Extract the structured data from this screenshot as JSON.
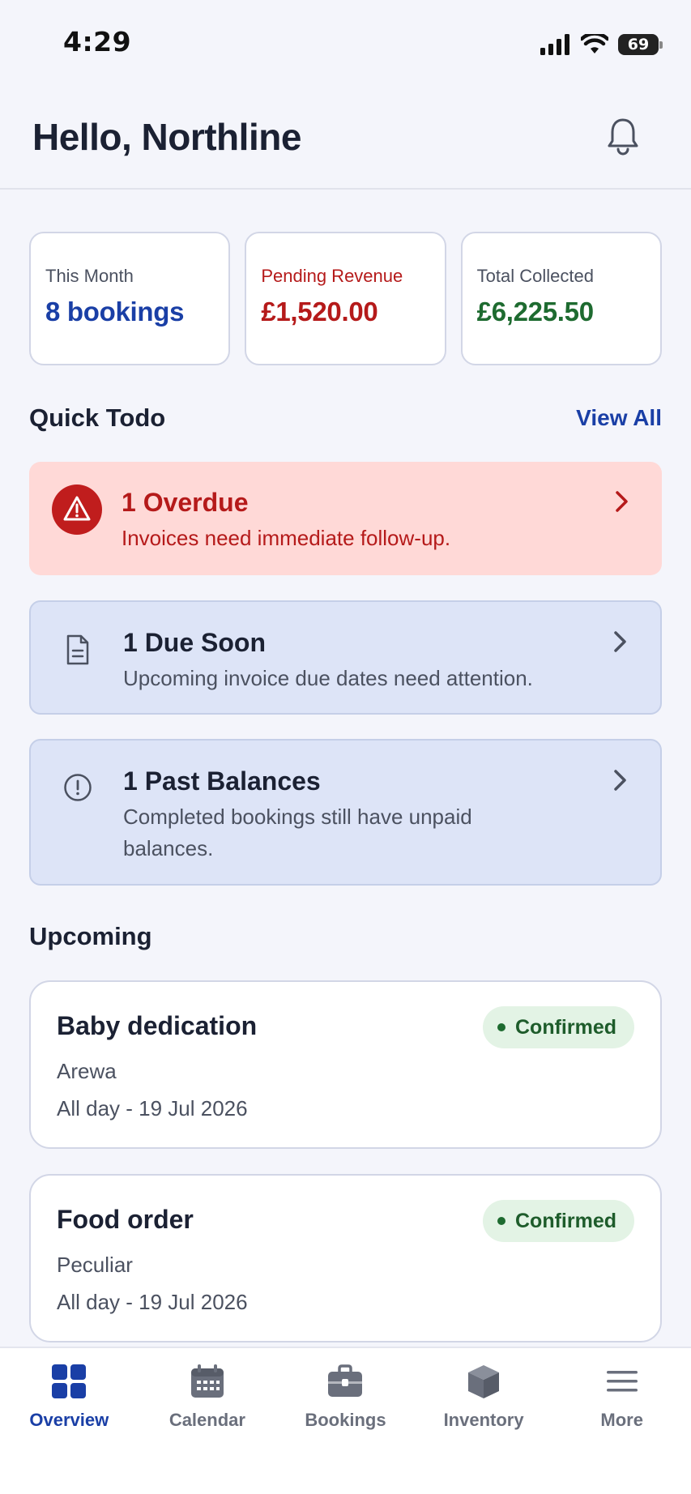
{
  "status_bar": {
    "time": "4:29",
    "battery": "69"
  },
  "header": {
    "greeting": "Hello, Northline",
    "notification_icon": "bell-icon"
  },
  "stats": [
    {
      "label": "This Month",
      "value": "8 bookings",
      "color": "#1a3fa6"
    },
    {
      "label": "Pending Revenue",
      "value": "£1,520.00",
      "color": "#b51a1a"
    },
    {
      "label": "Total Collected",
      "value": "£6,225.50",
      "color": "#1e6b30"
    }
  ],
  "quick_todo": {
    "title": "Quick Todo",
    "view_all": "View All",
    "items": [
      {
        "title": "1 Overdue",
        "description": "Invoices need immediate follow-up.",
        "icon": "warning-icon"
      },
      {
        "title": "1 Due Soon",
        "description": "Upcoming invoice due dates need attention.",
        "icon": "document-icon"
      },
      {
        "title": "1 Past Balances",
        "description": "Completed bookings still have unpaid balances.",
        "icon": "alert-circle-icon"
      }
    ]
  },
  "upcoming": {
    "title": "Upcoming",
    "bookings": [
      {
        "title": "Baby dedication",
        "client": "Arewa",
        "time": "All day - 19 Jul 2026",
        "status": "Confirmed"
      },
      {
        "title": "Food order",
        "client": "Peculiar",
        "time": "All day - 19 Jul 2026",
        "status": "Confirmed"
      }
    ]
  },
  "bottom_nav": {
    "items": [
      {
        "label": "Overview",
        "icon": "grid-icon",
        "active": true
      },
      {
        "label": "Calendar",
        "icon": "calendar-icon"
      },
      {
        "label": "Bookings",
        "icon": "briefcase-icon"
      },
      {
        "label": "Inventory",
        "icon": "box-icon"
      },
      {
        "label": "More",
        "icon": "menu-icon"
      }
    ]
  },
  "colors": {
    "accent": "#1a3fa6",
    "danger": "#b51a1a",
    "success": "#1e6b30",
    "overdue_bg": "#ffd9d7",
    "info_bg": "#dde4f7"
  }
}
